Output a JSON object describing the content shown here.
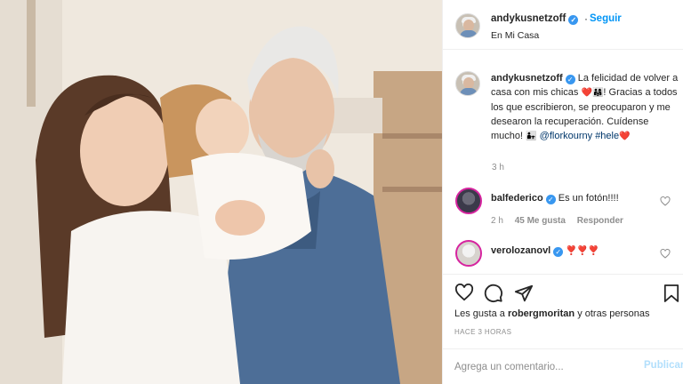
{
  "post": {
    "username": "andykusnetzoff",
    "follow_label": "Seguir",
    "location": "En Mi Casa",
    "more_label": "•••",
    "caption_parts": {
      "p1": "La felicidad de volver a casa con mis chicas",
      "p2": "! Gracias a todos los que escribieron, se preocuparon y me desearon la recuperación. Cuídense mucho!",
      "mention": "@florkourny",
      "hashtag": "#hele"
    },
    "caption_time": "3 h"
  },
  "comments": [
    {
      "username": "balfederico",
      "text": "Es un fotón!!!!",
      "time": "2 h",
      "likes": "45 Me gusta",
      "reply_label": "Responder"
    },
    {
      "username": "verolozanovl",
      "text": "❣️❣️❣️"
    }
  ],
  "footer": {
    "likes_prefix": "Les gusta a",
    "likes_user": "robergmoritan",
    "likes_suffix": "y otras personas",
    "age": "HACE 3 HORAS",
    "comment_placeholder": "Agrega un comentario...",
    "publish_label": "Publicar"
  },
  "icons": {
    "verified": "verified-badge-icon",
    "like": "heart-icon",
    "comment": "comment-icon",
    "share": "paper-plane-icon",
    "save": "bookmark-icon"
  },
  "colors": {
    "accent": "#0095f6",
    "verified": "#3897f0",
    "link": "#00376b",
    "publish_disabled": "#b2dffc",
    "heart": "#ed4956"
  }
}
